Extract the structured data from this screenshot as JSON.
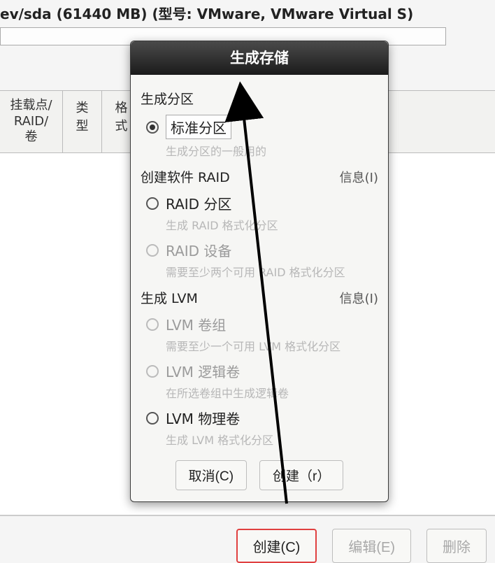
{
  "disk": {
    "label": "ev/sda (61440 MB) (型号: VMware, VMware Virtual S)"
  },
  "table_headers": {
    "col1": "挂载点/\nRAID/卷",
    "col2": "类型",
    "col3": "格式"
  },
  "dialog": {
    "title": "生成存储",
    "section1": {
      "title": "生成分区",
      "opt1": {
        "label": "标准分区",
        "desc": "生成分区的一般用的"
      }
    },
    "section2": {
      "title": "创建软件 RAID",
      "info": "信息(I)",
      "opt1": {
        "label": "RAID 分区",
        "desc": "生成 RAID 格式化分区"
      },
      "opt2": {
        "label": "RAID 设备",
        "desc": "需要至少两个可用 RAID 格式化分区"
      }
    },
    "section3": {
      "title": "生成 LVM",
      "info": "信息(I)",
      "opt1": {
        "label": "LVM 卷组",
        "desc": "需要至少一个可用 LVM 格式化分区"
      },
      "opt2": {
        "label": "LVM 逻辑卷",
        "desc": "在所选卷组中生成逻辑卷"
      },
      "opt3": {
        "label": "LVM 物理卷",
        "desc": "生成 LVM 格式化分区"
      }
    },
    "buttons": {
      "cancel": "取消(C)",
      "create": "创建（r）"
    }
  },
  "bottom": {
    "create": "创建(C)",
    "edit": "编辑(E)",
    "delete": "删除"
  }
}
